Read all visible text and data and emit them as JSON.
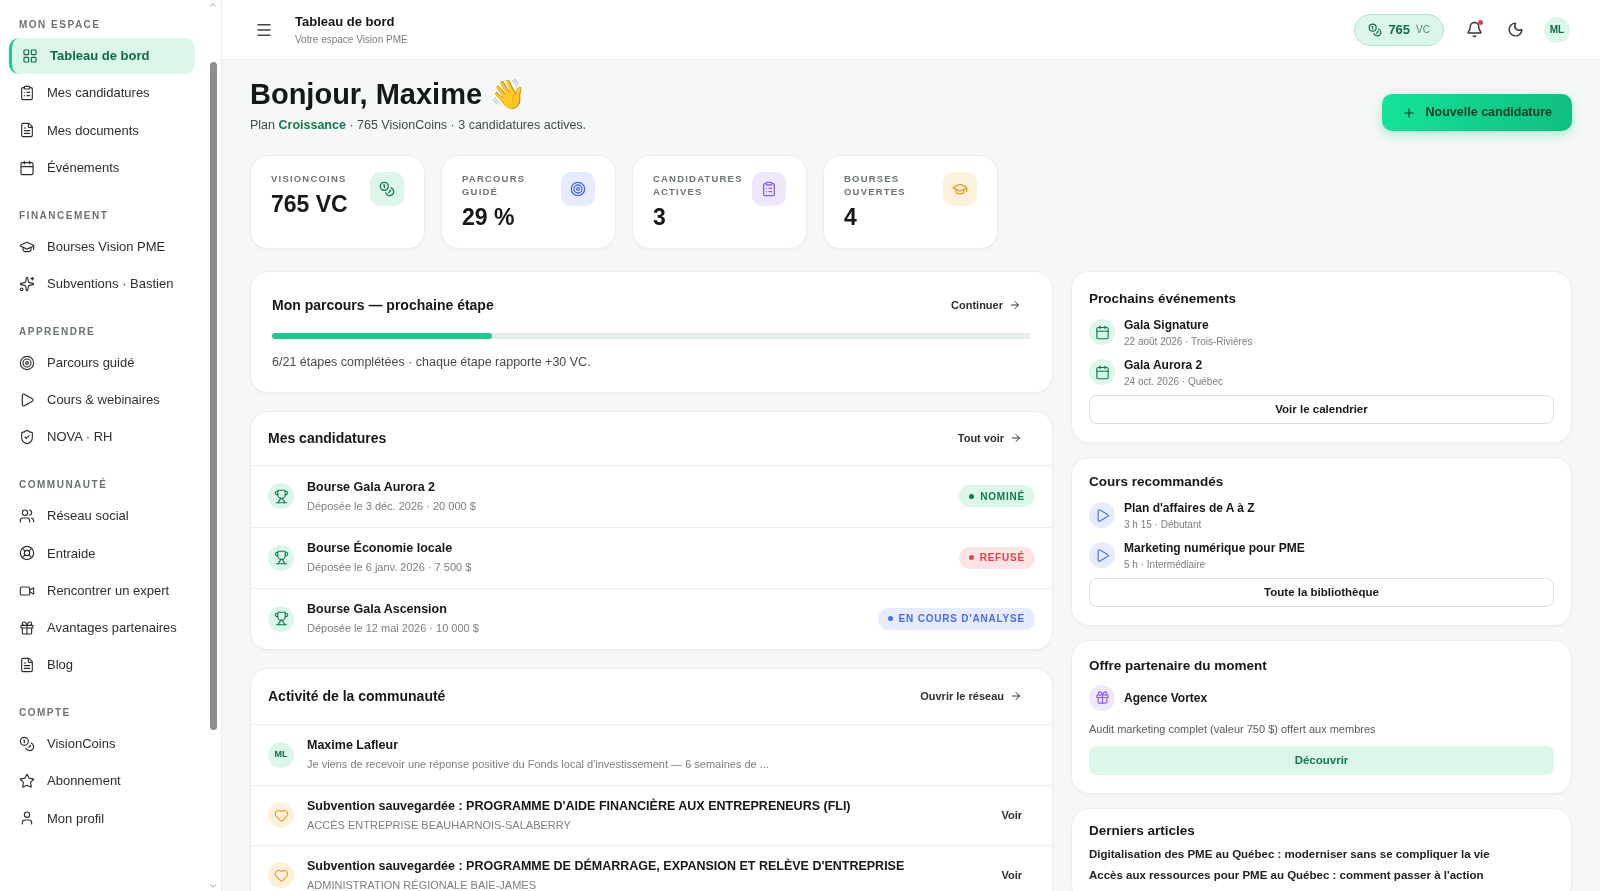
{
  "sidebar": {
    "sections": [
      {
        "title": "MON ESPACE",
        "items": [
          {
            "label": "Tableau de bord",
            "selected": true
          },
          {
            "label": "Mes candidatures",
            "selected": false
          },
          {
            "label": "Mes documents",
            "selected": false
          },
          {
            "label": "Événements",
            "selected": false
          }
        ]
      },
      {
        "title": "FINANCEMENT",
        "items": [
          {
            "label": "Bourses Vision PME",
            "selected": false
          },
          {
            "label": "Subventions · Bastien",
            "selected": false
          }
        ]
      },
      {
        "title": "APPRENDRE",
        "items": [
          {
            "label": "Parcours guidé",
            "selected": false
          },
          {
            "label": "Cours & webinaires",
            "selected": false
          },
          {
            "label": "NOVA · RH",
            "selected": false
          }
        ]
      },
      {
        "title": "COMMUNAUTÉ",
        "items": [
          {
            "label": "Réseau social",
            "selected": false
          },
          {
            "label": "Entraide",
            "selected": false
          },
          {
            "label": "Rencontrer un expert",
            "selected": false
          },
          {
            "label": "Avantages partenaires",
            "selected": false
          },
          {
            "label": "Blog",
            "selected": false
          }
        ]
      },
      {
        "title": "COMPTE",
        "items": [
          {
            "label": "VisionCoins",
            "selected": false
          },
          {
            "label": "Abonnement",
            "selected": false
          },
          {
            "label": "Mon profil",
            "selected": false
          }
        ]
      }
    ]
  },
  "header": {
    "title": "Tableau de bord",
    "subtitle": "Votre espace Vision PME",
    "coins": "765",
    "coins_unit": "VC",
    "notification": true,
    "avatar": "ML"
  },
  "greeting": {
    "title": "Bonjour, Maxime 👋",
    "subtitle": "Plan **Croissance** · 765 VisionCoins · 3 candidatures actives.",
    "button": "Nouvelle candidature"
  },
  "stats": [
    {
      "label": "VISIONCOINS",
      "value": "765 VC",
      "kind": "coins"
    },
    {
      "label": "PARCOURS GUIDÉ",
      "value": "29 %",
      "kind": "target"
    },
    {
      "label": "CANDIDATURES ACTIVES",
      "value": "3",
      "kind": "clipboard"
    },
    {
      "label": "BOURSES OUVERTES",
      "value": "4",
      "kind": "grad"
    }
  ],
  "journey": {
    "title": "Mon parcours — prochaine étape",
    "link": "Continuer",
    "level": 0.29,
    "note": "6/21 étapes complétées · chaque étape rapporte +30 VC."
  },
  "applications": {
    "title": "Mes candidatures",
    "link": "Tout voir",
    "rows": [
      {
        "name": "Bourse Gala Aurora 2",
        "detail": "Déposée le 3 déc. 2026 · 20 000 $",
        "status": "NOMINÉ",
        "kind": "success"
      },
      {
        "name": "Bourse Économie locale",
        "detail": "Déposée le 6 janv. 2026 · 7 500 $",
        "status": "REFUSÉ",
        "kind": "danger"
      },
      {
        "name": "Bourse Gala Ascension",
        "detail": "Déposée le 12 mai 2026 · 10 000 $",
        "status": "EN COURS D'ANALYSE",
        "kind": "info"
      }
    ]
  },
  "community": {
    "title": "Activité de la communauté",
    "link": "Ouvrir le réseau",
    "rows": [
      {
        "kind": "post",
        "avatar": "ML",
        "title": "Maxime Lafleur",
        "detail": "Je viens de recevoir une réponse positive du Fonds local d'investissement — 6 semaines de ..."
      },
      {
        "kind": "saved",
        "title": "Subvention sauvegardée : PROGRAMME D'AIDE FINANCIÈRE AUX ENTREPRENEURS (FLI)",
        "detail": "ACCÈS ENTREPRISE BEAUHARNOIS-SALABERRY",
        "action": "Voir"
      },
      {
        "kind": "saved",
        "title": "Subvention sauvegardée : PROGRAMME DE DÉMARRAGE, EXPANSION ET RELÈVE D'ENTREPRISE",
        "detail": "ADMINISTRATION RÉGIONALE BAIE-JAMES",
        "action": "Voir"
      }
    ]
  },
  "events": {
    "title": "Prochains événements",
    "items": [
      {
        "name": "Gala Signature",
        "detail": "22 août 2026 · Trois-Rivières"
      },
      {
        "name": "Gala Aurora 2",
        "detail": "24 oct. 2026 · Québec"
      }
    ],
    "button": "Voir le calendrier"
  },
  "courses": {
    "title": "Cours recommandés",
    "items": [
      {
        "name": "Plan d'affaires de A à Z",
        "detail": "3 h 15 · Débutant"
      },
      {
        "name": "Marketing numérique pour PME",
        "detail": "5 h · Intermédiaire"
      }
    ],
    "button": "Toute la bibliothèque"
  },
  "offer": {
    "title": "Offre partenaire du moment",
    "partner": "Agence Vortex",
    "text": "Audit marketing complet (valeur 750 $) offert aux membres",
    "button": "Découvrir"
  },
  "articles": {
    "title": "Derniers articles",
    "items": [
      "Digitalisation des PME au Québec : moderniser sans se compliquer la vie",
      "Accès aux ressources pour PME au Québec : comment passer à l'action"
    ]
  }
}
